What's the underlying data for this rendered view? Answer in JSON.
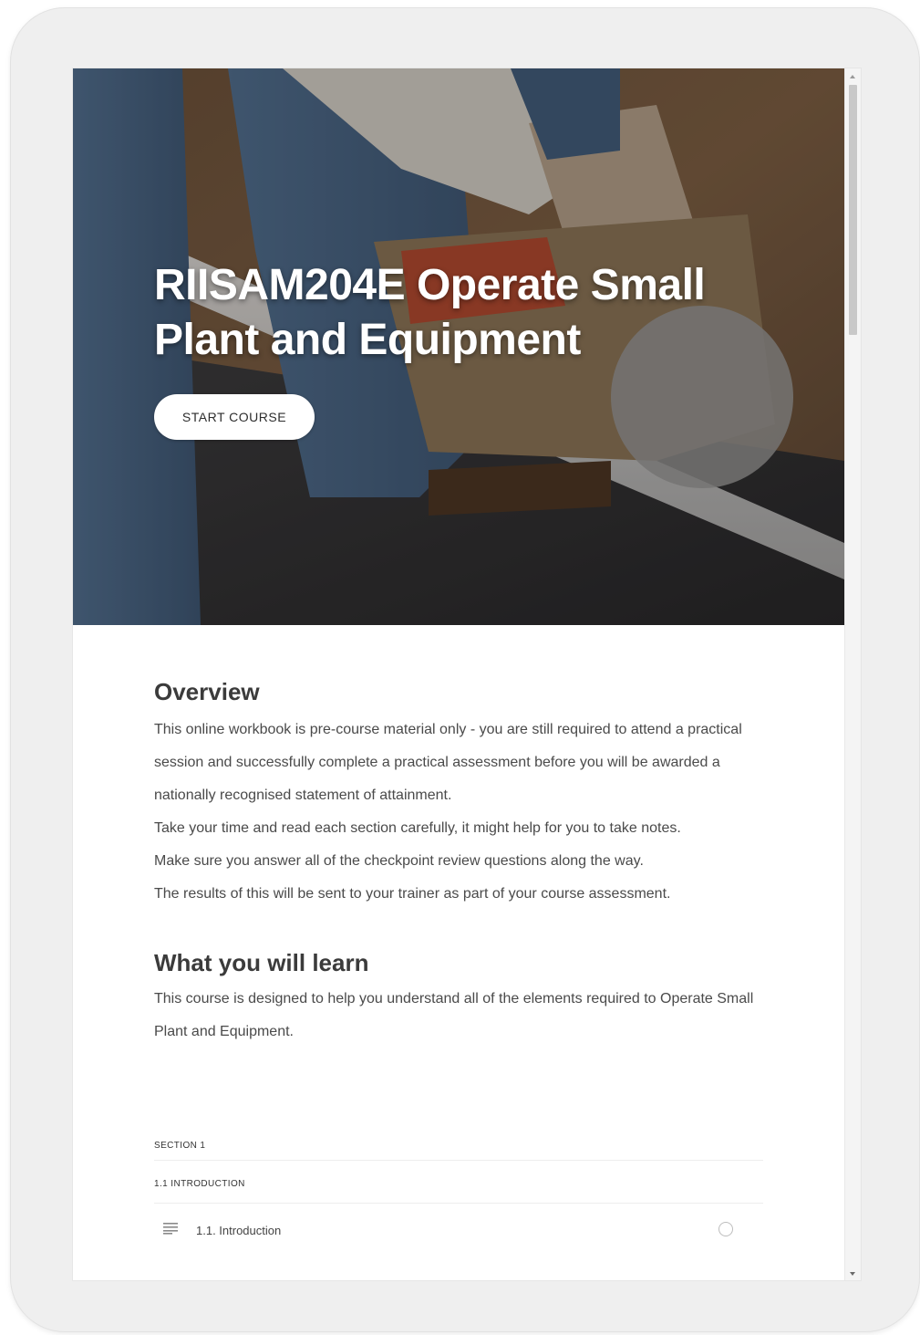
{
  "hero": {
    "title": "RIISAM204E Operate Small Plant and Equipment",
    "start_button_label": "START COURSE"
  },
  "overview": {
    "heading": "Overview",
    "paragraphs": [
      "This online workbook is pre-course material only - you are still required to attend a practical session and successfully complete a practical assessment before you will be awarded a nationally recognised statement of attainment.",
      "Take your time and read each section carefully, it might help for you to take notes.",
      "Make sure you answer all of the checkpoint review questions along the way.",
      "The results of this will be sent to your trainer as part of your course assessment."
    ]
  },
  "learn": {
    "heading": "What you will learn",
    "body": "This course is designed to help you understand all of the elements required to Operate Small Plant and Equipment."
  },
  "outline": {
    "section_label": "SECTION 1",
    "subsection_label": "1.1 INTRODUCTION",
    "lessons": [
      {
        "label": "1.1. Introduction",
        "icon": "text-lines-icon",
        "status": "not-started"
      }
    ]
  },
  "colors": {
    "heading": "#3b3b3b",
    "body_text": "#4a4a4a",
    "button_bg": "#ffffff",
    "frame": "#efefef"
  }
}
